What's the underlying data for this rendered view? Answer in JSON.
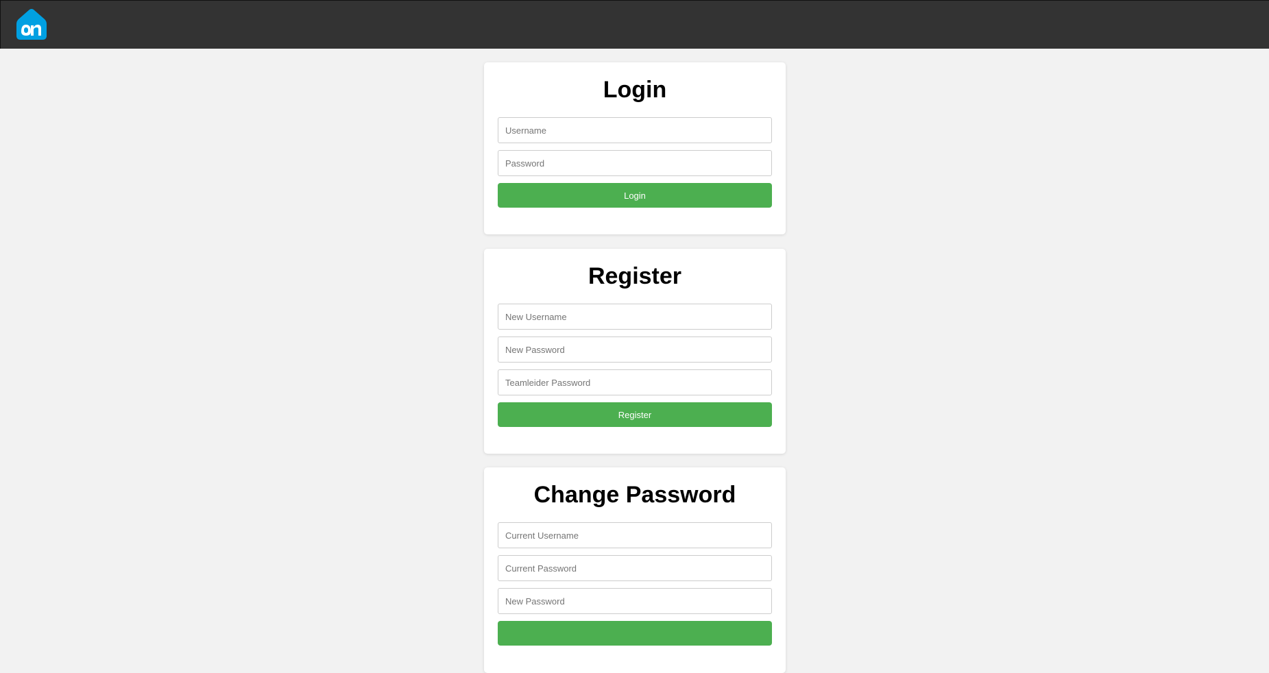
{
  "header": {
    "logo_icon": "albert-heijn-logo-icon",
    "logo_color": "#00a0e2",
    "background": "#333333"
  },
  "login": {
    "title": "Login",
    "username_placeholder": "Username",
    "password_placeholder": "Password",
    "button_label": "Login"
  },
  "register": {
    "title": "Register",
    "new_username_placeholder": "New Username",
    "new_password_placeholder": "New Password",
    "teamleider_password_placeholder": "Teamleider Password",
    "button_label": "Register"
  },
  "change_password": {
    "title": "Change Password",
    "current_username_placeholder": "Current Username",
    "current_password_placeholder": "Current Password",
    "new_password_placeholder": "New Password"
  },
  "colors": {
    "accent_green": "#4caf50",
    "page_background": "#f2f2f2",
    "card_background": "#ffffff"
  }
}
